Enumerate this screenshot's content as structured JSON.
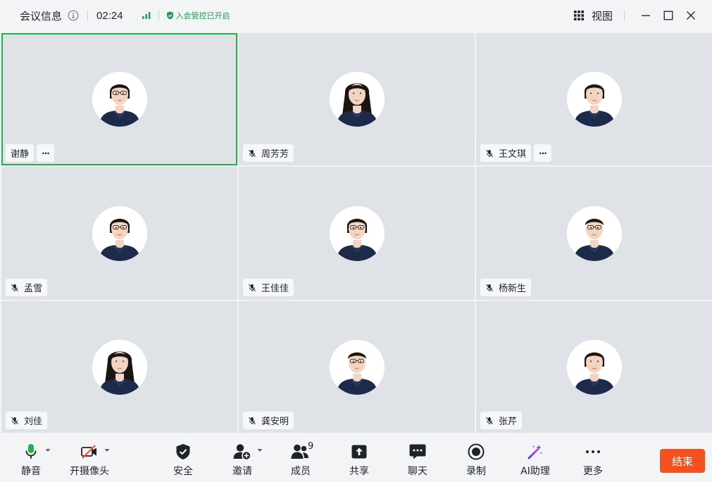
{
  "titlebar": {
    "meeting_info_label": "会议信息",
    "timer": "02:24",
    "admission_status": "入会管控已开启",
    "view_label": "视图"
  },
  "participants": [
    {
      "name": "谢静",
      "muted": false,
      "active_speaker": true,
      "has_more_menu": true,
      "hair": "short",
      "glasses": true
    },
    {
      "name": "周芳芳",
      "muted": true,
      "active_speaker": false,
      "has_more_menu": false,
      "hair": "long",
      "glasses": false
    },
    {
      "name": "王文琪",
      "muted": true,
      "active_speaker": false,
      "has_more_menu": true,
      "hair": "short",
      "glasses": false
    },
    {
      "name": "孟雪",
      "muted": true,
      "active_speaker": false,
      "has_more_menu": false,
      "hair": "short",
      "glasses": true
    },
    {
      "name": "王佳佳",
      "muted": true,
      "active_speaker": false,
      "has_more_menu": false,
      "hair": "short",
      "glasses": true
    },
    {
      "name": "杨新生",
      "muted": true,
      "active_speaker": false,
      "has_more_menu": false,
      "hair": "male",
      "glasses": true
    },
    {
      "name": "刘佳",
      "muted": true,
      "active_speaker": false,
      "has_more_menu": false,
      "hair": "long",
      "glasses": false
    },
    {
      "name": "龚安明",
      "muted": true,
      "active_speaker": false,
      "has_more_menu": false,
      "hair": "male",
      "glasses": true
    },
    {
      "name": "张芹",
      "muted": true,
      "active_speaker": false,
      "has_more_menu": false,
      "hair": "short",
      "glasses": false
    }
  ],
  "toolbar": {
    "mute_label": "静音",
    "camera_label": "开摄像头",
    "security_label": "安全",
    "invite_label": "邀请",
    "members_label": "成员",
    "members_count": "9",
    "share_label": "共享",
    "chat_label": "聊天",
    "record_label": "录制",
    "ai_label": "AI助理",
    "more_label": "更多",
    "end_label": "结束"
  },
  "colors": {
    "active_border": "#22b24c",
    "admission_green": "#1e9c50",
    "end_button": "#f5511e",
    "shirt_navy": "#1e2a4a",
    "ai_icon": "#6b4ef0"
  }
}
